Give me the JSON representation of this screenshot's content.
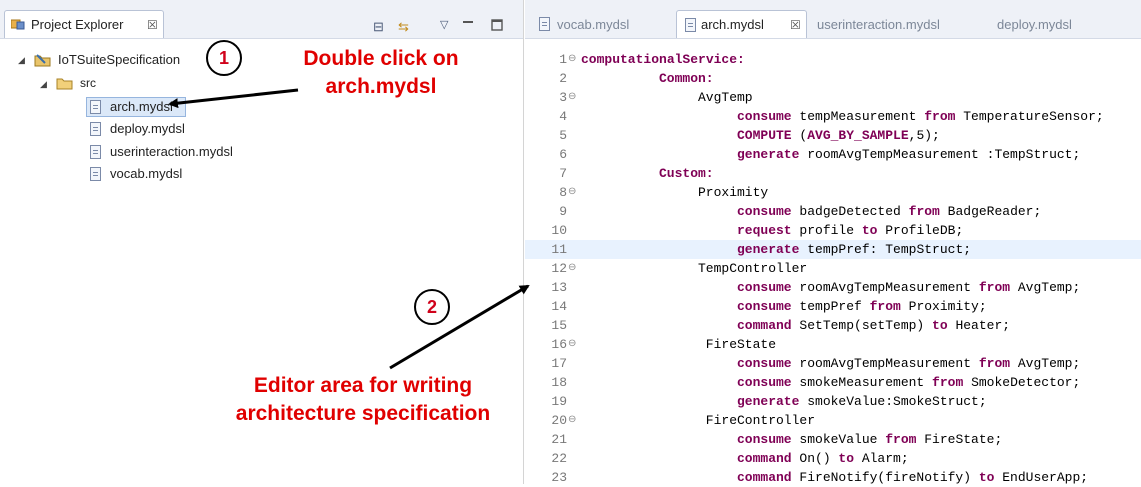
{
  "project_explorer": {
    "tab_label": "Project Explorer",
    "close_glyph": "☒",
    "toolbar": [
      {
        "name": "collapse-all-icon",
        "glyph": "⊟"
      },
      {
        "name": "link-with-editor-icon",
        "glyph": "⇆"
      },
      {
        "name": "view-menu-icon",
        "glyph": "▽"
      }
    ],
    "tree": {
      "project": "IoTSuiteSpecification",
      "folder": "src",
      "files": [
        "arch.mydsl",
        "deploy.mydsl",
        "userinteraction.mydsl",
        "vocab.mydsl"
      ],
      "selected": "arch.mydsl"
    }
  },
  "editor": {
    "tabs": [
      {
        "label": "vocab.mydsl",
        "active": false
      },
      {
        "label": "arch.mydsl",
        "active": true
      },
      {
        "label": "userinteraction.mydsl",
        "active": false
      },
      {
        "label": "deploy.mydsl",
        "active": false
      }
    ],
    "current_line": 11,
    "lines": [
      {
        "n": "1",
        "fold": "⊖",
        "indent": 0,
        "kw": "computationalService:",
        "rest": ""
      },
      {
        "n": "2",
        "fold": "",
        "indent": 10,
        "kw": "Common:",
        "rest": ""
      },
      {
        "n": "3",
        "fold": "⊖",
        "indent": 15,
        "kw": "",
        "rest": "AvgTemp"
      },
      {
        "n": "4",
        "fold": "",
        "indent": 20,
        "kw": "consume",
        "rest": " tempMeasurement ",
        "kw2": "from",
        "rest2": " TemperatureSensor;"
      },
      {
        "n": "5",
        "fold": "",
        "indent": 20,
        "kw": "COMPUTE",
        "rest": " (",
        "kw2": "AVG_BY_SAMPLE",
        "rest2": ",5);"
      },
      {
        "n": "6",
        "fold": "",
        "indent": 20,
        "kw": "generate",
        "rest": " roomAvgTempMeasurement :TempStruct;"
      },
      {
        "n": "7",
        "fold": "",
        "indent": 10,
        "kw": "Custom:",
        "rest": ""
      },
      {
        "n": "8",
        "fold": "⊖",
        "indent": 15,
        "kw": "",
        "rest": "Proximity"
      },
      {
        "n": "9",
        "fold": "",
        "indent": 20,
        "kw": "consume",
        "rest": " badgeDetected ",
        "kw2": "from",
        "rest2": " BadgeReader;"
      },
      {
        "n": "10",
        "fold": "",
        "indent": 20,
        "kw": "request",
        "rest": " profile ",
        "kw2": "to",
        "rest2": " ProfileDB;"
      },
      {
        "n": "11",
        "fold": "",
        "indent": 20,
        "kw": "generate",
        "rest": " tempPref: TempStruct;"
      },
      {
        "n": "12",
        "fold": "⊖",
        "indent": 15,
        "kw": "",
        "rest": "TempController"
      },
      {
        "n": "13",
        "fold": "",
        "indent": 20,
        "kw": "consume",
        "rest": " roomAvgTempMeasurement ",
        "kw2": "from",
        "rest2": " AvgTemp;"
      },
      {
        "n": "14",
        "fold": "",
        "indent": 20,
        "kw": "consume",
        "rest": " tempPref ",
        "kw2": "from",
        "rest2": " Proximity;"
      },
      {
        "n": "15",
        "fold": "",
        "indent": 20,
        "kw": "command",
        "rest": " SetTemp(setTemp) ",
        "kw2": "to",
        "rest2": " Heater;"
      },
      {
        "n": "16",
        "fold": "⊖",
        "indent": 16,
        "kw": "",
        "rest": "FireState"
      },
      {
        "n": "17",
        "fold": "",
        "indent": 20,
        "kw": "consume",
        "rest": " roomAvgTempMeasurement ",
        "kw2": "from",
        "rest2": " AvgTemp;"
      },
      {
        "n": "18",
        "fold": "",
        "indent": 20,
        "kw": "consume",
        "rest": " smokeMeasurement ",
        "kw2": "from",
        "rest2": " SmokeDetector;"
      },
      {
        "n": "19",
        "fold": "",
        "indent": 20,
        "kw": "generate",
        "rest": " smokeValue:SmokeStruct;"
      },
      {
        "n": "20",
        "fold": "⊖",
        "indent": 16,
        "kw": "",
        "rest": "FireController"
      },
      {
        "n": "21",
        "fold": "",
        "indent": 20,
        "kw": "consume",
        "rest": " smokeValue ",
        "kw2": "from",
        "rest2": " FireState;"
      },
      {
        "n": "22",
        "fold": "",
        "indent": 20,
        "kw": "command",
        "rest": " On() ",
        "kw2": "to",
        "rest2": " Alarm;"
      },
      {
        "n": "23",
        "fold": "",
        "indent": 20,
        "kw": "command",
        "rest": " FireNotify(fireNotify) ",
        "kw2": "to",
        "rest2": " EndUserApp;"
      }
    ]
  },
  "annotations": {
    "step1": {
      "number": "1",
      "text_line1": "Double click on",
      "text_line2": "arch.mydsl"
    },
    "step2": {
      "number": "2",
      "text_line1": "Editor area for writing",
      "text_line2": "architecture specification"
    },
    "color": "#e00000"
  },
  "colors": {
    "keyword": "#7f0055",
    "current_line": "#e8f2fe",
    "selection": "#dbe8f8"
  }
}
